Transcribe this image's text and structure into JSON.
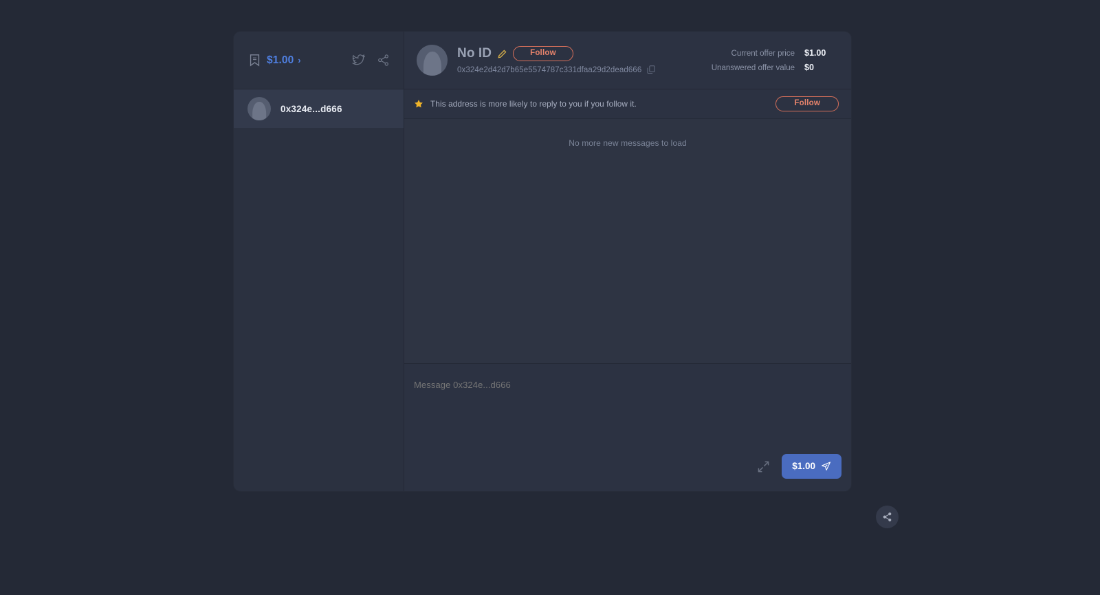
{
  "sidebar": {
    "header": {
      "bookmark_icon": "bookmark-icon",
      "price": "$1.00",
      "chevron": "›",
      "twitter_icon": "twitter-icon",
      "share_icon": "share-icon"
    },
    "conversations": [
      {
        "name": "0x324e...d666",
        "avatar": "avatar-placeholder"
      }
    ]
  },
  "header": {
    "avatar": "avatar-placeholder",
    "title": "No ID",
    "edit_icon": "pencil-icon",
    "follow_label": "Follow",
    "address": "0x324e2d42d7b65e5574787c331dfaa29d2dead666",
    "copy_icon": "copy-icon",
    "offers": [
      {
        "label": "Current offer price",
        "value": "$1.00"
      },
      {
        "label": "Unanswered offer value",
        "value": "$0"
      }
    ]
  },
  "notice": {
    "star_icon": "star-icon",
    "text": "This address is more likely to reply to you if you follow it.",
    "follow_label": "Follow"
  },
  "messages": {
    "empty_state": "No more new messages to load"
  },
  "composer": {
    "placeholder": "Message 0x324e...d666",
    "value": "",
    "expand_icon": "expand-icon",
    "send_label": "$1.00",
    "send_icon": "send-icon"
  },
  "fab": {
    "icon": "share-icon"
  },
  "colors": {
    "page_bg": "#242936",
    "panel_bg": "#2c3242",
    "sidebar_bg": "#2b3140",
    "accent_blue": "#4f7fe0",
    "send_blue": "#4a6cc0",
    "follow_orange": "#e8846c",
    "star_yellow": "#f0b429"
  }
}
